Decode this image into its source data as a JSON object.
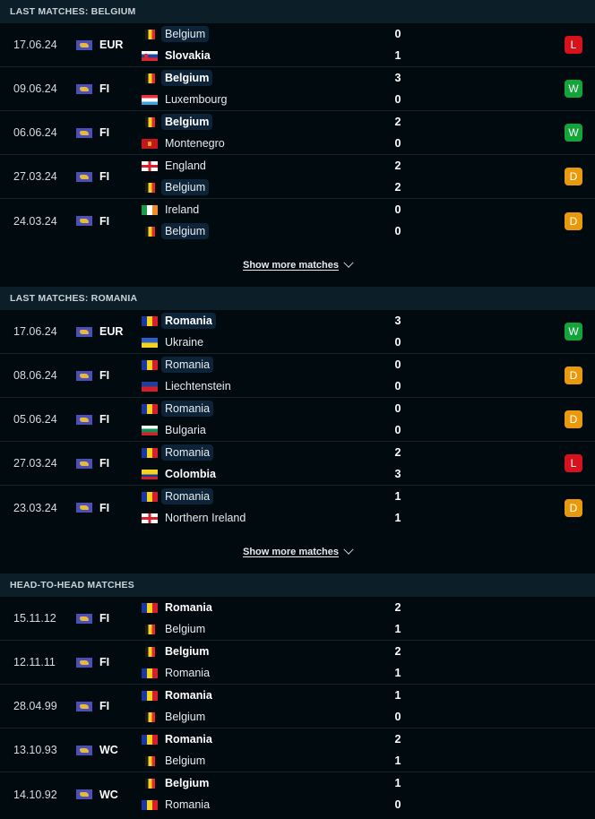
{
  "flags": {
    "Belgium": {
      "type": "v3",
      "colors": [
        "#1a1a1a",
        "#f6d21c",
        "#e8262d"
      ],
      "narrow": true
    },
    "Slovakia": {
      "type": "h3",
      "colors": [
        "#ffffff",
        "#1a47a6",
        "#e2252c"
      ],
      "emblem": "#e2252c"
    },
    "Luxembourg": {
      "type": "h3",
      "colors": [
        "#e8313b",
        "#ffffff",
        "#3aa2e0"
      ]
    },
    "Montenegro": {
      "type": "solid",
      "colors": [
        "#c8141c"
      ],
      "emblem": "#d4a92a"
    },
    "England": {
      "type": "cross",
      "colors": [
        "#ffffff",
        "#d81e2a"
      ]
    },
    "Ireland": {
      "type": "v3",
      "colors": [
        "#1a9a4a",
        "#ffffff",
        "#f08a2a"
      ]
    },
    "Romania": {
      "type": "v3",
      "colors": [
        "#1937a0",
        "#f6d21c",
        "#d81e2a"
      ]
    },
    "Ukraine": {
      "type": "h2",
      "colors": [
        "#2d5fc4",
        "#f6d21c"
      ]
    },
    "Liechtenstein": {
      "type": "h2",
      "colors": [
        "#1f3f9a",
        "#d81e2a"
      ]
    },
    "Bulgaria": {
      "type": "h3",
      "colors": [
        "#ffffff",
        "#119255",
        "#d81e2a"
      ]
    },
    "Colombia": {
      "type": "h3c",
      "colors": [
        "#f6d21c",
        "#1937a0",
        "#d81e2a"
      ]
    },
    "Northern Ireland": {
      "type": "cross",
      "colors": [
        "#ffffff",
        "#d81e2a"
      ]
    }
  },
  "sections": [
    {
      "title": "LAST MATCHES: BELGIUM",
      "show_more": "Show more matches",
      "matches": [
        {
          "date": "17.06.24",
          "comp": "EUR",
          "home": "Belgium",
          "away": "Slovakia",
          "home_score": "0",
          "away_score": "1",
          "highlight": "home",
          "winner": "away",
          "result": "L"
        },
        {
          "date": "09.06.24",
          "comp": "FI",
          "home": "Belgium",
          "away": "Luxembourg",
          "home_score": "3",
          "away_score": "0",
          "highlight": "home",
          "winner": "home",
          "result": "W"
        },
        {
          "date": "06.06.24",
          "comp": "FI",
          "home": "Belgium",
          "away": "Montenegro",
          "home_score": "2",
          "away_score": "0",
          "highlight": "home",
          "winner": "home",
          "result": "W"
        },
        {
          "date": "27.03.24",
          "comp": "FI",
          "home": "England",
          "away": "Belgium",
          "home_score": "2",
          "away_score": "2",
          "highlight": "away",
          "winner": "",
          "result": "D"
        },
        {
          "date": "24.03.24",
          "comp": "FI",
          "home": "Ireland",
          "away": "Belgium",
          "home_score": "0",
          "away_score": "0",
          "highlight": "away",
          "winner": "",
          "result": "D"
        }
      ]
    },
    {
      "title": "LAST MATCHES: ROMANIA",
      "show_more": "Show more matches",
      "matches": [
        {
          "date": "17.06.24",
          "comp": "EUR",
          "home": "Romania",
          "away": "Ukraine",
          "home_score": "3",
          "away_score": "0",
          "highlight": "home",
          "winner": "home",
          "result": "W"
        },
        {
          "date": "08.06.24",
          "comp": "FI",
          "home": "Romania",
          "away": "Liechtenstein",
          "home_score": "0",
          "away_score": "0",
          "highlight": "home",
          "winner": "",
          "result": "D"
        },
        {
          "date": "05.06.24",
          "comp": "FI",
          "home": "Romania",
          "away": "Bulgaria",
          "home_score": "0",
          "away_score": "0",
          "highlight": "home",
          "winner": "",
          "result": "D"
        },
        {
          "date": "27.03.24",
          "comp": "FI",
          "home": "Romania",
          "away": "Colombia",
          "home_score": "2",
          "away_score": "3",
          "highlight": "home",
          "winner": "away",
          "result": "L"
        },
        {
          "date": "23.03.24",
          "comp": "FI",
          "home": "Romania",
          "away": "Northern Ireland",
          "home_score": "1",
          "away_score": "1",
          "highlight": "home",
          "winner": "",
          "result": "D"
        }
      ]
    },
    {
      "title": "HEAD-TO-HEAD MATCHES",
      "show_more": "",
      "matches": [
        {
          "date": "15.11.12",
          "comp": "FI",
          "home": "Romania",
          "away": "Belgium",
          "home_score": "2",
          "away_score": "1",
          "highlight": "",
          "winner": "home",
          "result": ""
        },
        {
          "date": "12.11.11",
          "comp": "FI",
          "home": "Belgium",
          "away": "Romania",
          "home_score": "2",
          "away_score": "1",
          "highlight": "",
          "winner": "home",
          "result": ""
        },
        {
          "date": "28.04.99",
          "comp": "FI",
          "home": "Romania",
          "away": "Belgium",
          "home_score": "1",
          "away_score": "0",
          "highlight": "",
          "winner": "home",
          "result": ""
        },
        {
          "date": "13.10.93",
          "comp": "WC",
          "home": "Romania",
          "away": "Belgium",
          "home_score": "2",
          "away_score": "1",
          "highlight": "",
          "winner": "home",
          "result": ""
        },
        {
          "date": "14.10.92",
          "comp": "WC",
          "home": "Belgium",
          "away": "Romania",
          "home_score": "1",
          "away_score": "0",
          "highlight": "",
          "winner": "home",
          "result": ""
        }
      ]
    }
  ]
}
